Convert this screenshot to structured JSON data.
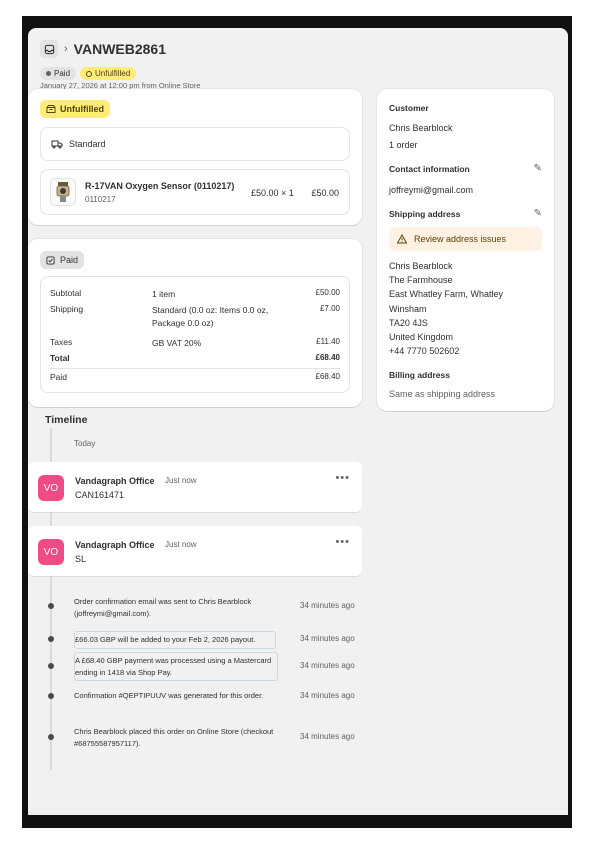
{
  "header": {
    "order_number": "VANWEB2861",
    "badges": {
      "paid": "Paid",
      "unfulfilled": "Unfulfilled"
    },
    "date_line": "January 27, 2026 at 12:00 pm from Online Store"
  },
  "fulfillment": {
    "status_label": "Unfulfilled",
    "shipping_method": "Standard",
    "line_item": {
      "name": "R-17VAN Oxygen Sensor (0110217)",
      "sku": "0110217",
      "price_qty": "£50.00  × 1",
      "total": "£50.00"
    }
  },
  "payment": {
    "status_label": "Paid",
    "rows": [
      {
        "label": "Subtotal",
        "detail": "1 item",
        "amount": "£50.00"
      },
      {
        "label": "Shipping",
        "detail": "Standard (0.0 oz: Items 0.0 oz, Package 0.0 oz)",
        "amount": "£7.00"
      },
      {
        "label": "Taxes",
        "detail": "GB VAT 20%",
        "amount": "£11.40"
      },
      {
        "label": "Total",
        "detail": "",
        "amount": "£68.40"
      },
      {
        "label": "Paid",
        "detail": "",
        "amount": "£68.40"
      }
    ]
  },
  "customer": {
    "heading": "Customer",
    "name": "Chris Bearblock",
    "orders": "1 order",
    "contact_heading": "Contact information",
    "email": "joffreymi@gmail.com",
    "shipping_heading": "Shipping address",
    "review_label": "Review address issues",
    "address_lines": [
      "Chris Bearblock",
      "The Farmhouse",
      "East Whatley Farm, Whatley",
      "Winsham",
      "TA20 4JS",
      "United Kingdom",
      "+44 7770 502602"
    ],
    "billing_heading": "Billing address",
    "billing_value": "Same as shipping address"
  },
  "timeline": {
    "title": "Timeline",
    "day_label": "Today",
    "comments": [
      {
        "initials": "VO",
        "author": "Vandagraph Office",
        "time": "Just now",
        "text": "CAN161471"
      },
      {
        "initials": "VO",
        "author": "Vandagraph Office",
        "time": "Just now",
        "text": "SL"
      }
    ],
    "events": [
      {
        "text": "Order confirmation email was sent to Chris Bearblock (joffreymi@gmail.com).",
        "time": "34 minutes ago"
      },
      {
        "text": "£66.03 GBP will be added to your Feb 2, 2026 payout.",
        "time": "34 minutes ago"
      },
      {
        "text": "A £68.40 GBP payment was processed using a Mastercard ending in 1418 via Shop Pay.",
        "time": "34 minutes ago"
      },
      {
        "text": "Confirmation #QEPTIPUUV was generated for this order.",
        "time": "34 minutes ago"
      },
      {
        "text": "Chris Bearblock placed this order on Online Store (checkout #68755587957117).",
        "time": "34 minutes ago"
      }
    ]
  },
  "colors": {
    "unfulfilled_bg": "#ffeb78",
    "avatar": "#ef4b85",
    "review_bg": "#fff1e3"
  }
}
